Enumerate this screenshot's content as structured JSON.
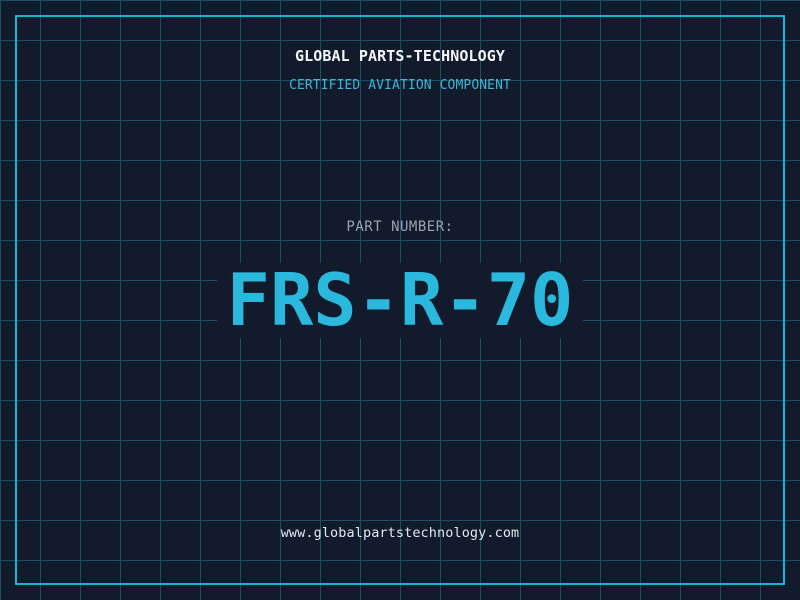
{
  "colors": {
    "bg": "#111b2c",
    "grid": "#1b4f68",
    "frame": "#0db8dc",
    "title": "#f4f6f8",
    "subtitle": "#3fb6d8",
    "partLabel": "#9aa3ae",
    "partNumber": "#2ab8dc",
    "url": "#e2e8ee"
  },
  "header": {
    "company_name": "GLOBAL PARTS-TECHNOLOGY",
    "subtitle": "CERTIFIED AVIATION COMPONENT"
  },
  "part": {
    "label": "PART NUMBER:",
    "number": "FRS-R-70"
  },
  "footer": {
    "website": "www.globalpartstechnology.com"
  }
}
